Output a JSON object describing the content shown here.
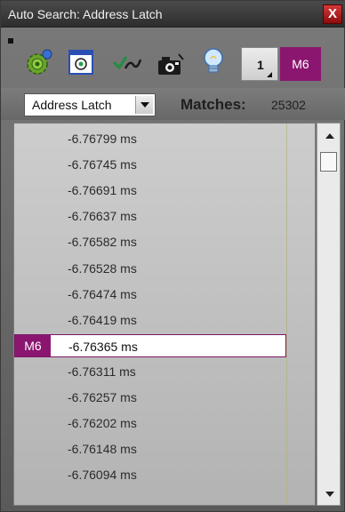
{
  "window": {
    "title": "Auto Search: Address Latch",
    "close_label": "X"
  },
  "toolbar": {
    "icons": [
      "grip-icon",
      "gear-icon",
      "window-icon",
      "check-wave-icon",
      "camera-icon",
      "bulb-icon"
    ],
    "counter_value": "1",
    "marker_label": "M6"
  },
  "search": {
    "selected": "Address Latch",
    "matches_label": "Matches:",
    "matches_value": "25302"
  },
  "results": {
    "rows": [
      {
        "text": "-6.76799 ms",
        "selected": false,
        "badge": ""
      },
      {
        "text": "-6.76745 ms",
        "selected": false,
        "badge": ""
      },
      {
        "text": "-6.76691 ms",
        "selected": false,
        "badge": ""
      },
      {
        "text": "-6.76637 ms",
        "selected": false,
        "badge": ""
      },
      {
        "text": "-6.76582 ms",
        "selected": false,
        "badge": ""
      },
      {
        "text": "-6.76528 ms",
        "selected": false,
        "badge": ""
      },
      {
        "text": "-6.76474 ms",
        "selected": false,
        "badge": ""
      },
      {
        "text": "-6.76419 ms",
        "selected": false,
        "badge": ""
      },
      {
        "text": "-6.76365 ms",
        "selected": true,
        "badge": "M6"
      },
      {
        "text": "-6.76311 ms",
        "selected": false,
        "badge": ""
      },
      {
        "text": "-6.76257 ms",
        "selected": false,
        "badge": ""
      },
      {
        "text": "-6.76202 ms",
        "selected": false,
        "badge": ""
      },
      {
        "text": "-6.76148 ms",
        "selected": false,
        "badge": ""
      },
      {
        "text": "-6.76094 ms",
        "selected": false,
        "badge": ""
      }
    ]
  },
  "colors": {
    "marker": "#8b1670",
    "titlebar": "#3a3a3a",
    "close": "#b01c1c"
  }
}
